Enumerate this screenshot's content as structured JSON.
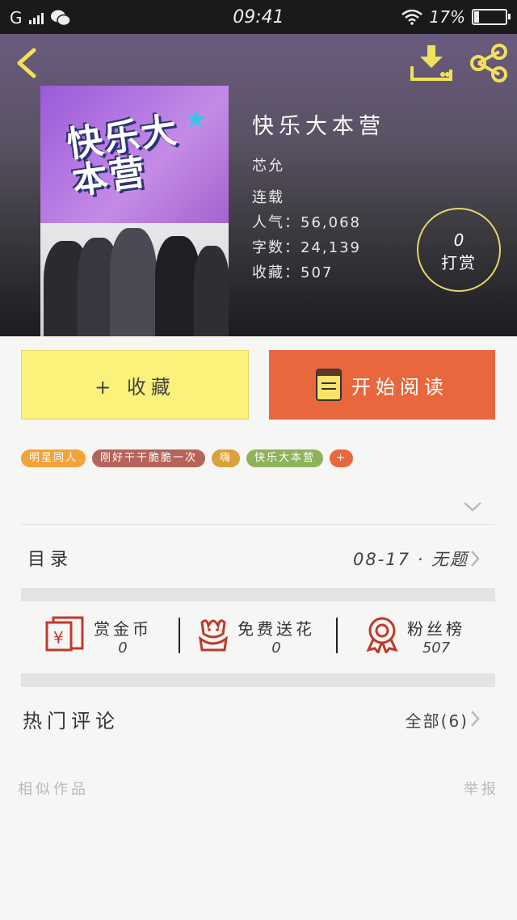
{
  "status_bar": {
    "carrier": "G",
    "time": "09:41",
    "battery": "17%"
  },
  "book": {
    "title": "快乐大本营",
    "author": "芯允",
    "status": "连载",
    "popularity": "人气：56,068",
    "word_count": "字数：24,139",
    "favorites": "收藏：507"
  },
  "tip": {
    "count": "0",
    "label": "打赏"
  },
  "actions": {
    "favorite_label": "+ 收藏",
    "read_label": "开始阅读"
  },
  "tags": [
    {
      "label": "明星同人",
      "color": "#f4a23a"
    },
    {
      "label": "刚好干干脆脆一次",
      "color": "#b5645a"
    },
    {
      "label": "嗨",
      "color": "#d9a23a"
    },
    {
      "label": "快乐大本营",
      "color": "#8fb35a"
    },
    {
      "label": "+",
      "color": "#e8673d"
    }
  ],
  "toc": {
    "label": "目录",
    "latest": "08-17 · 无题"
  },
  "stats": {
    "coins_label": "赏金币",
    "coins_value": "0",
    "flowers_label": "免费送花",
    "flowers_value": "0",
    "fans_label": "粉丝榜",
    "fans_value": "507"
  },
  "comments": {
    "title": "热门评论",
    "all_label": "全部(6)"
  },
  "footer": {
    "similar": "相似作品",
    "report": "举报"
  },
  "colors": {
    "accent_yellow": "#fbf27b",
    "accent_orange": "#e8673d",
    "icon_red": "#c0392b"
  }
}
